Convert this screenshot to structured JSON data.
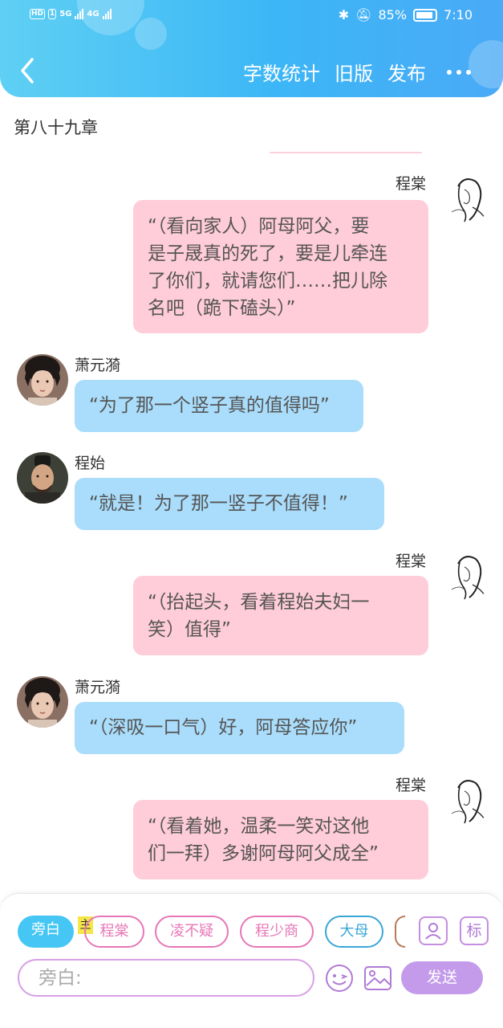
{
  "status_bar": {
    "network_left": "HD",
    "sim": "1",
    "net1": "5G",
    "net2": "4G",
    "battery": "85%",
    "time": "7:10"
  },
  "header": {
    "actions": [
      "字数统计",
      "旧版",
      "发布"
    ]
  },
  "chapter_title": "第八十九章",
  "messages": [
    {
      "speaker": "程棠",
      "side": "right",
      "text_lines": [
        "“（看向家人）阿母阿父，要",
        "是子晟真的死了，要是儿牵连",
        "了你们，就请您们……把儿除",
        "名吧（跪下磕头）”"
      ]
    },
    {
      "speaker": "萧元漪",
      "side": "left",
      "text_lines": [
        "“为了那一个竖子真的值得吗”"
      ]
    },
    {
      "speaker": "程始",
      "side": "left",
      "text_lines": [
        "“就是！为了那一竖子不值得！”"
      ]
    },
    {
      "speaker": "程棠",
      "side": "right",
      "text_lines": [
        "“（抬起头，看着程始夫妇一",
        "笑）值得”"
      ]
    },
    {
      "speaker": "萧元漪",
      "side": "left",
      "text_lines": [
        "“（深吸一口气）好，阿母答应你”"
      ]
    },
    {
      "speaker": "程棠",
      "side": "right",
      "text_lines": [
        "“（看着她，温柔一笑对这他",
        "们一拜）多谢阿母阿父成全”"
      ]
    }
  ],
  "composer": {
    "chips": [
      "旁白",
      "程棠",
      "凌不疑",
      "程少商",
      "大母"
    ],
    "main_tag": "主",
    "label_button": "标",
    "input_placeholder": "旁白:",
    "send_label": "发送"
  },
  "colors": {
    "header_gradient_start": "#5fd0f4",
    "header_gradient_end": "#4aaaf7",
    "right_bubble": "#ffccd9",
    "left_bubble": "#a9ddfb",
    "send_button": "#c39bea",
    "active_chip": "#45c6f5"
  }
}
